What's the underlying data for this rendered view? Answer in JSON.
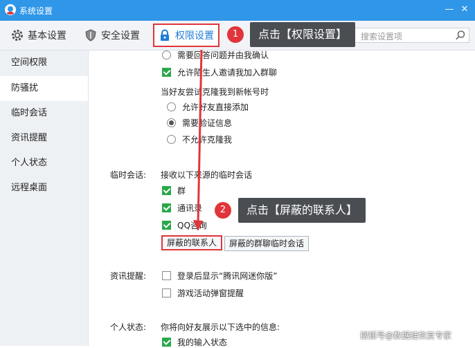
{
  "window": {
    "title": "系统设置"
  },
  "tabs": [
    {
      "label": "基本设置",
      "icon": "gear-icon"
    },
    {
      "label": "安全设置",
      "icon": "shield-icon"
    },
    {
      "label": "权限设置",
      "icon": "lock-icon"
    }
  ],
  "search": {
    "placeholder": "搜索设置项"
  },
  "sidebar": {
    "items": [
      {
        "label": "空间权限"
      },
      {
        "label": "防骚扰"
      },
      {
        "label": "临时会话"
      },
      {
        "label": "资讯提醒"
      },
      {
        "label": "个人状态"
      },
      {
        "label": "远程桌面"
      }
    ]
  },
  "content": {
    "friend_options": [
      {
        "label": "需要回答问题并由我确认",
        "type": "radio",
        "checked": false
      },
      {
        "label": "允许陌生人邀请我加入群聊",
        "type": "checkbox",
        "checked": true
      }
    ],
    "clone": {
      "heading": "当好友尝试克隆我到新帐号时",
      "options": [
        {
          "label": "允许好友直接添加",
          "checked": false
        },
        {
          "label": "需要验证信息",
          "checked": true
        },
        {
          "label": "不允许克隆我",
          "checked": false
        }
      ]
    },
    "temp_session": {
      "section_label": "临时会话:",
      "heading": "接收以下来源的临时会话",
      "options": [
        {
          "label": "群",
          "checked": true
        },
        {
          "label": "通讯录",
          "checked": true
        },
        {
          "label": "QQ咨询",
          "checked": true
        }
      ],
      "blocked_contacts_button": "屏蔽的联系人",
      "blocked_group_button": "屏蔽的群聊临时会话"
    },
    "news": {
      "section_label": "资讯提醒:",
      "options": [
        {
          "label": "登录后显示“腾讯网迷你版”",
          "checked": false
        },
        {
          "label": "游戏活动弹窗提醒",
          "checked": false
        }
      ]
    },
    "status": {
      "section_label": "个人状态:",
      "heading": "你将向好友展示以下选中的信息:",
      "options": [
        {
          "label": "我的输入状态",
          "checked": true
        }
      ]
    }
  },
  "annotations": [
    {
      "number": "1",
      "text": "点击【权限设置】"
    },
    {
      "number": "2",
      "text": "点击【屏蔽的联系人】"
    }
  ],
  "watermark": "搜狐号@数据蛙恢复专家",
  "colors": {
    "titlebar": "#2f96e8",
    "highlight": "#e0353a",
    "checked": "#2aa84a",
    "active_tab": "#1f7cd6"
  }
}
